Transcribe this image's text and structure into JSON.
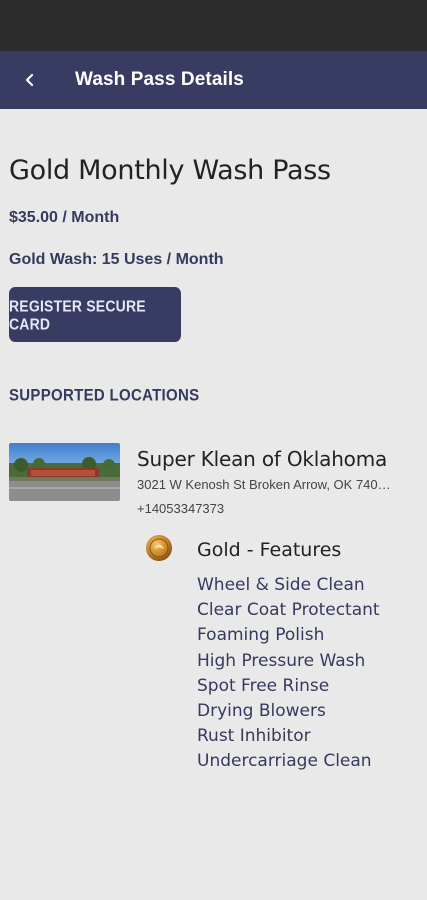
{
  "app_bar": {
    "title": "Wash Pass Details",
    "back_icon": "chevron-left-icon"
  },
  "pass": {
    "name": "Gold Monthly Wash Pass",
    "price": "$35.00 / Month",
    "uses": "Gold Wash: 15 Uses / Month",
    "register_button": "REGISTER SECURE CARD"
  },
  "locations": {
    "heading": "SUPPORTED LOCATIONS",
    "items": [
      {
        "name": "Super Klean of Oklahoma",
        "address": "3021 W Kenosh St Broken Arrow, OK 740…",
        "phone": "+14053347373",
        "tier": {
          "icon": "gold-medal-icon",
          "title": "Gold - Features",
          "features": [
            "Wheel & Side Clean",
            "Clear Coat Protectant",
            "Foaming Polish",
            "High Pressure Wash",
            "Spot Free Rinse",
            "Drying Blowers",
            "Rust Inhibitor",
            "Undercarriage Clean"
          ]
        }
      }
    ]
  },
  "colors": {
    "status_bar": "#2c2c2c",
    "app_bar": "#383c63",
    "background": "#e9e9e9",
    "accent_text": "#353a5e",
    "gold": "#c8832a"
  }
}
